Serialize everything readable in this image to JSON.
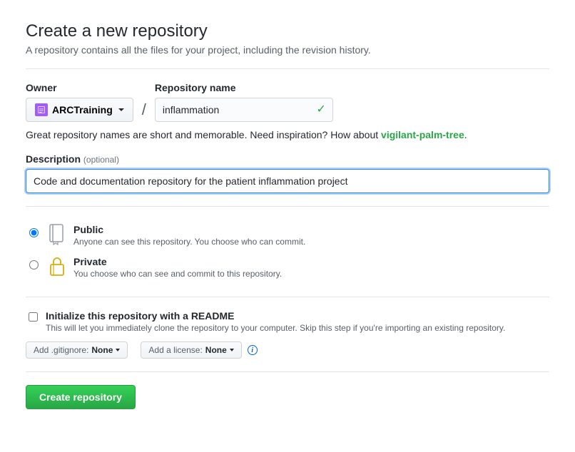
{
  "header": {
    "title": "Create a new repository",
    "subtitle": "A repository contains all the files for your project, including the revision history."
  },
  "owner": {
    "label": "Owner",
    "name": "ARCTraining"
  },
  "repo": {
    "label": "Repository name",
    "value": "inflammation"
  },
  "hint": {
    "prefix": "Great repository names are short and memorable. Need inspiration? How about ",
    "suggestion": "vigilant-palm-tree",
    "suffix": "."
  },
  "description": {
    "label": "Description",
    "optional": "(optional)",
    "value": "Code and documentation repository for the patient inflammation project"
  },
  "visibility": {
    "public": {
      "title": "Public",
      "desc": "Anyone can see this repository. You choose who can commit."
    },
    "private": {
      "title": "Private",
      "desc": "You choose who can see and commit to this repository."
    }
  },
  "readme": {
    "title": "Initialize this repository with a README",
    "desc": "This will let you immediately clone the repository to your computer. Skip this step if you're importing an existing repository."
  },
  "gitignore": {
    "prefix": "Add .gitignore: ",
    "value": "None"
  },
  "license": {
    "prefix": "Add a license: ",
    "value": "None"
  },
  "submit": "Create repository"
}
